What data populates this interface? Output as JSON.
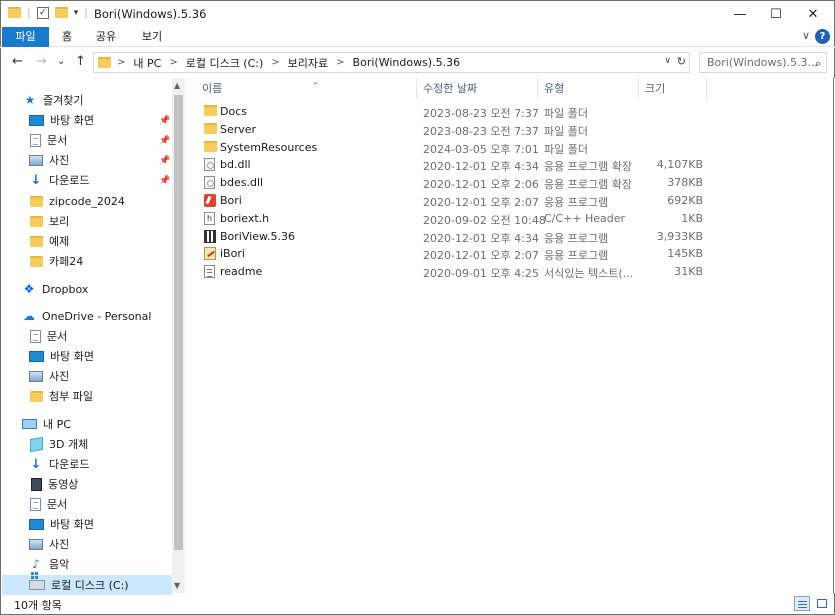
{
  "window": {
    "title": "Bori(Windows).5.36",
    "controls": {
      "minimize": "—",
      "maximize": "☐",
      "close": "✕"
    }
  },
  "ribbon": {
    "tabs": [
      "파일",
      "홈",
      "공유",
      "보기"
    ],
    "help": "?",
    "accent": "#1979ca"
  },
  "nav": {
    "back": "←",
    "forward": "→",
    "recent": "⌄",
    "up": "↑",
    "breadcrumb": [
      "내 PC",
      "로컬 디스크 (C:)",
      "보리자료",
      "Bori(Windows).5.36"
    ],
    "search_placeholder": "Bori(Windows).5.3..."
  },
  "sidebar": {
    "quick_access": {
      "label": "즐겨찾기",
      "items": [
        {
          "label": "바탕 화면",
          "icon": "desktop-icon",
          "pinned": true
        },
        {
          "label": "문서",
          "icon": "document-icon",
          "pinned": true
        },
        {
          "label": "사진",
          "icon": "pictures-icon",
          "pinned": true
        },
        {
          "label": "다운로드",
          "icon": "download-icon",
          "pinned": true
        },
        {
          "label": "zipcode_2024",
          "icon": "folder-icon",
          "pinned": false
        },
        {
          "label": "보리",
          "icon": "folder-icon",
          "pinned": false
        },
        {
          "label": "예제",
          "icon": "folder-icon",
          "pinned": false
        },
        {
          "label": "카페24",
          "icon": "folder-icon",
          "pinned": false
        }
      ]
    },
    "dropbox": {
      "label": "Dropbox"
    },
    "onedrive": {
      "label": "OneDrive - Personal",
      "items": [
        {
          "label": "문서",
          "icon": "document-icon"
        },
        {
          "label": "바탕 화면",
          "icon": "desktop-icon"
        },
        {
          "label": "사진",
          "icon": "pictures-icon"
        },
        {
          "label": "첨부 파일",
          "icon": "folder-icon"
        }
      ]
    },
    "this_pc": {
      "label": "내 PC",
      "items": [
        {
          "label": "3D 개체",
          "icon": "3d-objects-icon"
        },
        {
          "label": "다운로드",
          "icon": "download-icon"
        },
        {
          "label": "동영상",
          "icon": "video-icon"
        },
        {
          "label": "문서",
          "icon": "document-icon"
        },
        {
          "label": "바탕 화면",
          "icon": "desktop-icon"
        },
        {
          "label": "사진",
          "icon": "pictures-icon"
        },
        {
          "label": "음악",
          "icon": "music-icon"
        },
        {
          "label": "로컬 디스크 (C:)",
          "icon": "drive-icon",
          "selected": true
        }
      ]
    }
  },
  "columns": {
    "name": "이름",
    "date": "수정한 날짜",
    "type": "유형",
    "size": "크기"
  },
  "files": [
    {
      "name": "Docs",
      "date": "2023-08-23 오전 7:37",
      "type": "파일 폴더",
      "size": "",
      "icon": "folder-icon"
    },
    {
      "name": "Server",
      "date": "2023-08-23 오전 7:37",
      "type": "파일 폴더",
      "size": "",
      "icon": "folder-icon"
    },
    {
      "name": "SystemResources",
      "date": "2024-03-05 오후 7:01",
      "type": "파일 폴더",
      "size": "",
      "icon": "folder-icon"
    },
    {
      "name": "bd.dll",
      "date": "2020-12-01 오후 4:34",
      "type": "응용 프로그램 확장",
      "size": "4,107KB",
      "icon": "dll-icon"
    },
    {
      "name": "bdes.dll",
      "date": "2020-12-01 오후 2:06",
      "type": "응용 프로그램 확장",
      "size": "378KB",
      "icon": "dll-icon"
    },
    {
      "name": "Bori",
      "date": "2020-12-01 오후 2:07",
      "type": "응용 프로그램",
      "size": "692KB",
      "icon": "bori-app-icon"
    },
    {
      "name": "boriext.h",
      "date": "2020-09-02 오전 10:48",
      "type": "C/C++ Header",
      "size": "1KB",
      "icon": "header-file-icon"
    },
    {
      "name": "BoriView.5.36",
      "date": "2020-12-01 오후 4:34",
      "type": "응용 프로그램",
      "size": "3,933KB",
      "icon": "boriview-app-icon"
    },
    {
      "name": "iBori",
      "date": "2020-12-01 오후 2:07",
      "type": "응용 프로그램",
      "size": "145KB",
      "icon": "ibori-app-icon"
    },
    {
      "name": "readme",
      "date": "2020-09-01 오후 4:25",
      "type": "서식있는 텍스트(...",
      "size": "31KB",
      "icon": "rich-text-icon"
    }
  ],
  "status": {
    "count": "10개 항목"
  }
}
